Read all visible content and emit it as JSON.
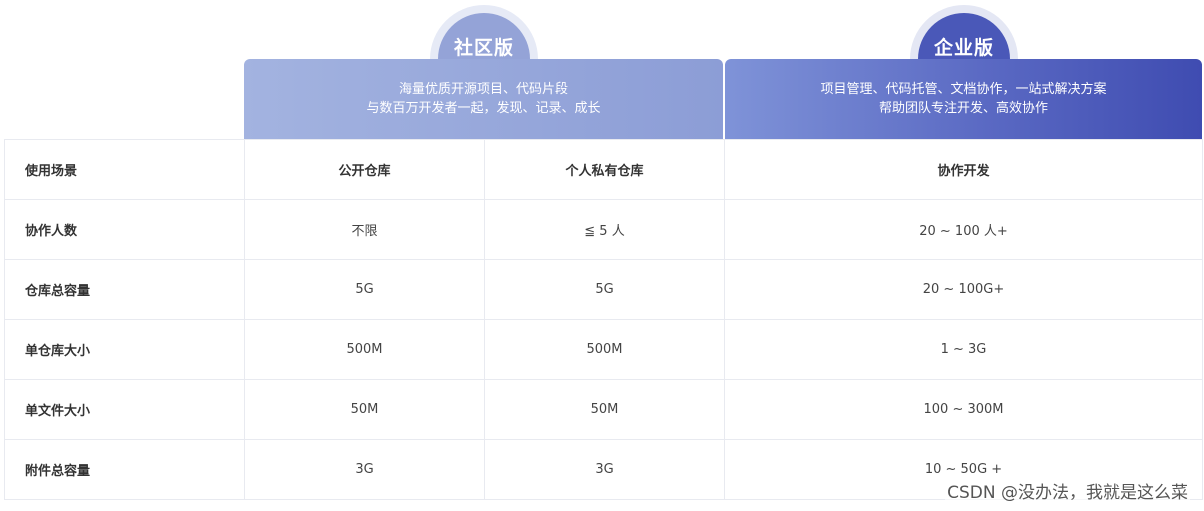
{
  "plans": {
    "community": {
      "name": "社区版",
      "desc_line1": "海量优质开源项目、代码片段",
      "desc_line2": "与数百万开发者一起，发现、记录、成长"
    },
    "enterprise": {
      "name": "企业版",
      "desc_line1": "项目管理、代码托管、文档协作，一站式解决方案",
      "desc_line2": "帮助团队专注开发、高效协作"
    }
  },
  "table": {
    "header": [
      "使用场景",
      "公开仓库",
      "个人私有仓库",
      "协作开发"
    ],
    "rows": [
      [
        "协作人数",
        "不限",
        "≦ 5 人",
        "20 ~ 100 人+"
      ],
      [
        "仓库总容量",
        "5G",
        "5G",
        "20 ~ 100G+"
      ],
      [
        "单仓库大小",
        "500M",
        "500M",
        "1 ~ 3G"
      ],
      [
        "单文件大小",
        "50M",
        "50M",
        "100 ~ 300M"
      ],
      [
        "附件总容量",
        "3G",
        "3G",
        "10 ~ 50G +"
      ]
    ]
  },
  "watermark": "CSDN @没办法，我就是这么菜"
}
